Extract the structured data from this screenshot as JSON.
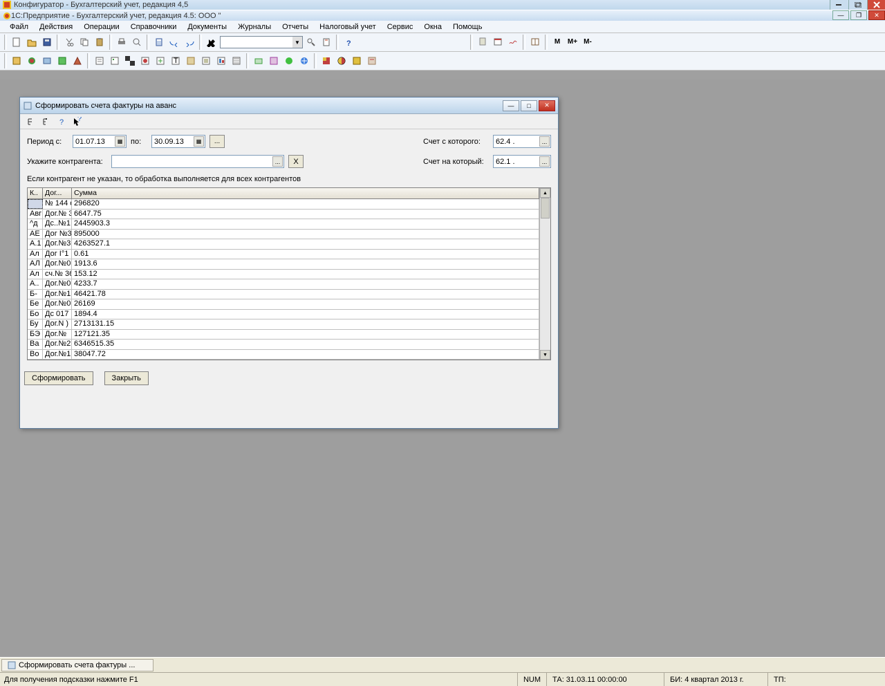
{
  "outer_title": "Конфигуратор - Бухгалтерский учет, редакция 4,5",
  "inner_title": "1С:Предприятие - Бухгалтерский учет, редакция 4.5: ООО \"",
  "menu": [
    "Файл",
    "Действия",
    "Операции",
    "Справочники",
    "Документы",
    "Журналы",
    "Отчеты",
    "Налоговый учет",
    "Сервис",
    "Окна",
    "Помощь"
  ],
  "tb_txt": {
    "m": "М",
    "mplus": "М+",
    "mminus": "М-"
  },
  "dialog": {
    "title": "Сформировать счета фактуры на аванс",
    "period_label": "Период с:",
    "date_from": "01.07.13",
    "to_label": "по:",
    "date_to": "30.09.13",
    "acc_from_label": "Счет с которого:",
    "acc_from": "62.4 .",
    "acc_to_label": "Счет на который:",
    "acc_to": "62.1 .",
    "agent_label": "Укажите контрагента:",
    "agent_value": "",
    "note": "Если контрагент не указан, то обработка выполняется для всех контрагентов",
    "headers": {
      "k": "К..",
      "dog": "Дог...",
      "sum": "Сумма"
    },
    "rows": [
      {
        "k": "",
        "d": "№ 144 о",
        "s": "296820"
      },
      {
        "k": "Авг",
        "d": "Дог.№ 3",
        "s": "6647.75"
      },
      {
        "k": "^д",
        "d": "Дс..№1",
        "s": "2445903.3"
      },
      {
        "k": "АЕ",
        "d": "Дог №3",
        "s": "895000"
      },
      {
        "k": "А.1",
        "d": "Дог.№3",
        "s": "4263527.1"
      },
      {
        "k": "Ал",
        "d": "Дог І°1",
        "s": "0.61"
      },
      {
        "k": "АЛ",
        "d": "Дог.№0",
        "s": "1913.6"
      },
      {
        "k": "Ал",
        "d": "сч.№ 36",
        "s": "153.12"
      },
      {
        "k": "А..",
        "d": "Дог.№0",
        "s": "4233.7"
      },
      {
        "k": "Б-",
        "d": "Дог.№1",
        "s": "46421.78"
      },
      {
        "k": "Бе",
        "d": "Дог.№0",
        "s": "26169"
      },
      {
        "k": "Бо",
        "d": "Дс 017",
        "s": "1894.4"
      },
      {
        "k": "Бу",
        "d": "Дог.N )",
        "s": "2713131.15"
      },
      {
        "k": "БЭ",
        "d": "Дог.№",
        "s": "127121.35"
      },
      {
        "k": "Ва",
        "d": "Дог.№2",
        "s": "6346515.35"
      },
      {
        "k": "Во",
        "d": "Дог.№1",
        "s": "38047.72"
      }
    ],
    "btn_form": "Сформировать",
    "btn_close": "Закрыть"
  },
  "taskbar_item": "Сформировать счета фактуры ...",
  "status": {
    "hint": "Для получения подсказки нажмите F1",
    "num": "NUM",
    "ta": "ТА: 31.03.11  00:00:00",
    "bi": "БИ: 4 квартал 2013 г.",
    "tp": "ТП:"
  }
}
